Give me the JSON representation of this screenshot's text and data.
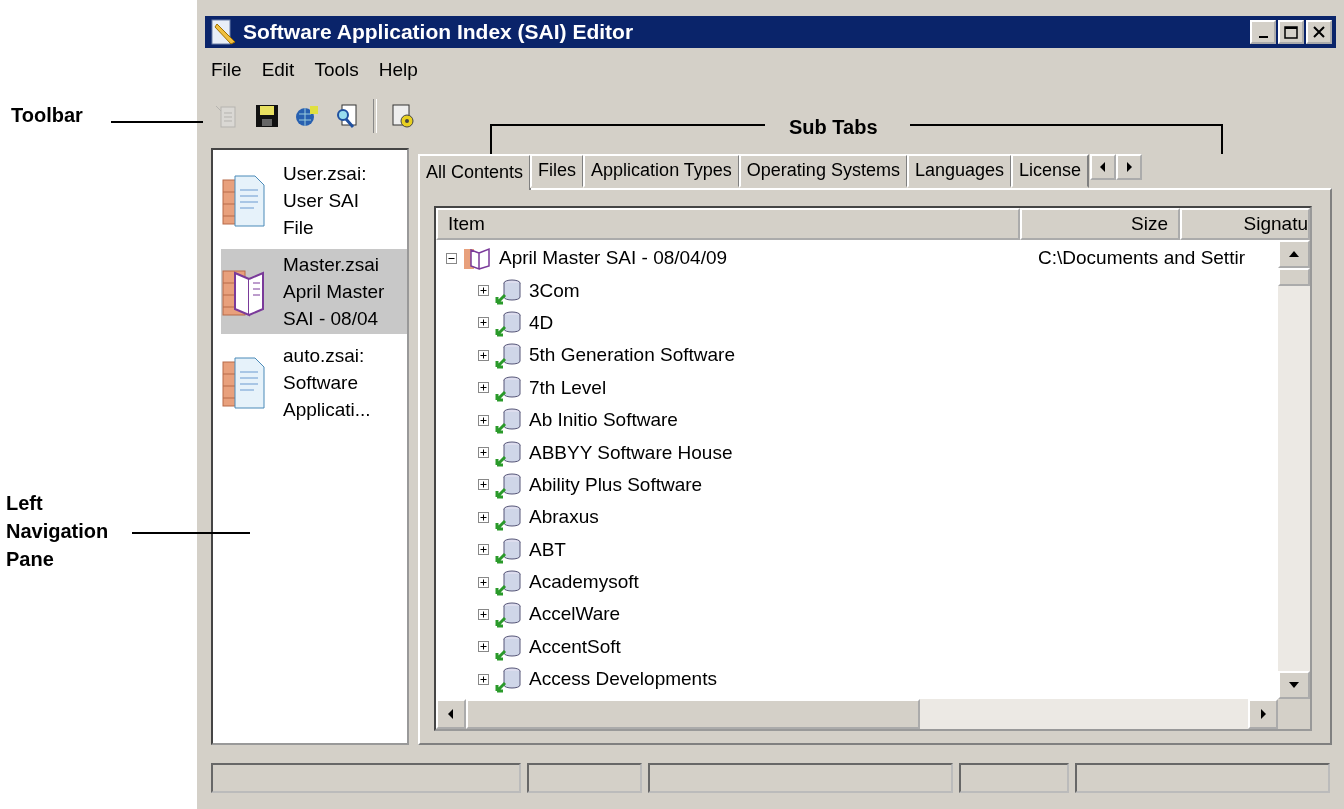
{
  "callouts": {
    "toolbar": "Toolbar",
    "left_pane": "Left Navigation Pane",
    "sub_tabs": "Sub Tabs"
  },
  "window": {
    "title": "Software Application Index (SAI) Editor"
  },
  "menu": [
    "File",
    "Edit",
    "Tools",
    "Help"
  ],
  "toolbar": [
    {
      "kind": "paste",
      "disabled": true
    },
    {
      "kind": "save",
      "disabled": false
    },
    {
      "kind": "globe",
      "disabled": false
    },
    {
      "kind": "find",
      "disabled": false
    },
    {
      "kind": "config",
      "disabled": false
    }
  ],
  "nav_items": [
    {
      "kind": "document",
      "lines": [
        "User.zsai:",
        "User SAI",
        "File"
      ],
      "selected": false
    },
    {
      "kind": "book",
      "lines": [
        "Master.zsai",
        "April Master",
        "SAI - 08/04"
      ],
      "selected": true
    },
    {
      "kind": "document",
      "lines": [
        "auto.zsai:",
        "Software",
        "Applicati..."
      ],
      "selected": false
    }
  ],
  "tabs": [
    {
      "label": "All Contents",
      "selected": true
    },
    {
      "label": "Files",
      "selected": false
    },
    {
      "label": "Application Types",
      "selected": false
    },
    {
      "label": "Operating Systems",
      "selected": false
    },
    {
      "label": "Languages",
      "selected": false
    },
    {
      "label": "License",
      "selected": false
    }
  ],
  "table": {
    "columns": [
      "Item",
      "Size",
      "Signatu"
    ],
    "tree": [
      {
        "label": "April Master SAI - 08/04/09",
        "size": "C:\\Documents and Settir",
        "expanded": true,
        "children": [
          {
            "label": "3Com",
            "expanded": false
          },
          {
            "label": "4D",
            "expanded": false
          },
          {
            "label": "5th Generation Software",
            "expanded": false
          },
          {
            "label": "7th Level",
            "expanded": false
          },
          {
            "label": "Ab Initio Software",
            "expanded": false
          },
          {
            "label": "ABBYY Software House",
            "expanded": false
          },
          {
            "label": "Ability Plus Software",
            "expanded": false
          },
          {
            "label": "Abraxus",
            "expanded": false
          },
          {
            "label": "ABT",
            "expanded": false
          },
          {
            "label": "Academysoft",
            "expanded": false
          },
          {
            "label": "AccelWare",
            "expanded": false
          },
          {
            "label": "AccentSoft",
            "expanded": false
          },
          {
            "label": "Access Developments",
            "expanded": false
          }
        ]
      }
    ]
  }
}
